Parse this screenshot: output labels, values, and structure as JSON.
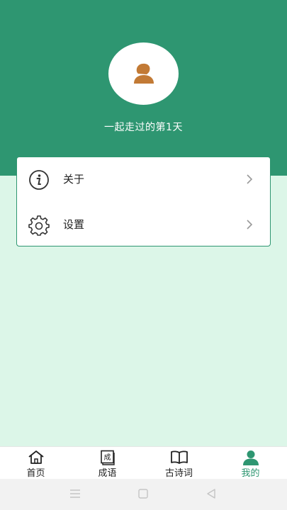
{
  "profile": {
    "days_text": "一起走过的第1天"
  },
  "menu": {
    "items": [
      {
        "label": "关于",
        "icon": "info-icon"
      },
      {
        "label": "设置",
        "icon": "gear-icon"
      }
    ]
  },
  "tabs": [
    {
      "label": "首页",
      "icon": "home-icon",
      "active": false
    },
    {
      "label": "成语",
      "icon": "idiom-book-icon",
      "active": false
    },
    {
      "label": "古诗词",
      "icon": "open-book-icon",
      "active": false
    },
    {
      "label": "我的",
      "icon": "person-icon",
      "active": true
    }
  ],
  "colors": {
    "primary": "#2e9671",
    "background": "#dcf6e8",
    "avatar_accent": "#c27a35"
  }
}
